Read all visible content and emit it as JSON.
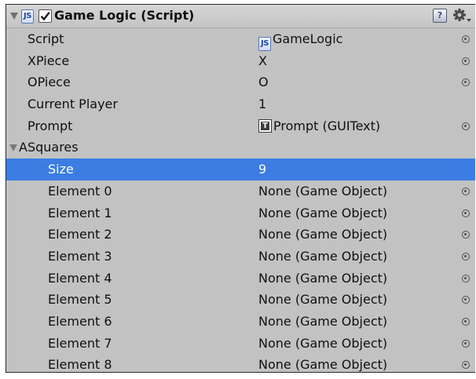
{
  "component": {
    "title": "Game Logic (Script)",
    "enabled": true,
    "icon": "js-script-icon",
    "js_icon_text": "JS",
    "help_icon_text": "?"
  },
  "fields": [
    {
      "label": "Script",
      "value": "GameLogic",
      "icon": "js-script-icon",
      "picker": true
    },
    {
      "label": "XPiece",
      "value": "X",
      "picker": true
    },
    {
      "label": "OPiece",
      "value": "O",
      "picker": true
    },
    {
      "label": "Current Player",
      "value": "1",
      "picker": false
    },
    {
      "label": "Prompt",
      "value": "Prompt (GUIText)",
      "icon": "guitext-icon",
      "icon_text": "T",
      "picker": true
    }
  ],
  "array": {
    "label": "ASquares",
    "expanded": true,
    "size_label": "Size",
    "size_value": "9",
    "elements": [
      {
        "label": "Element 0",
        "value": "None (Game Object)"
      },
      {
        "label": "Element 1",
        "value": "None (Game Object)"
      },
      {
        "label": "Element 2",
        "value": "None (Game Object)"
      },
      {
        "label": "Element 3",
        "value": "None (Game Object)"
      },
      {
        "label": "Element 4",
        "value": "None (Game Object)"
      },
      {
        "label": "Element 5",
        "value": "None (Game Object)"
      },
      {
        "label": "Element 6",
        "value": "None (Game Object)"
      },
      {
        "label": "Element 7",
        "value": "None (Game Object)"
      },
      {
        "label": "Element 8",
        "value": "None (Game Object)"
      }
    ]
  },
  "colors": {
    "panel_background": "#c2c2c2",
    "selection_highlight": "#3b7de2",
    "text": "#101010"
  }
}
